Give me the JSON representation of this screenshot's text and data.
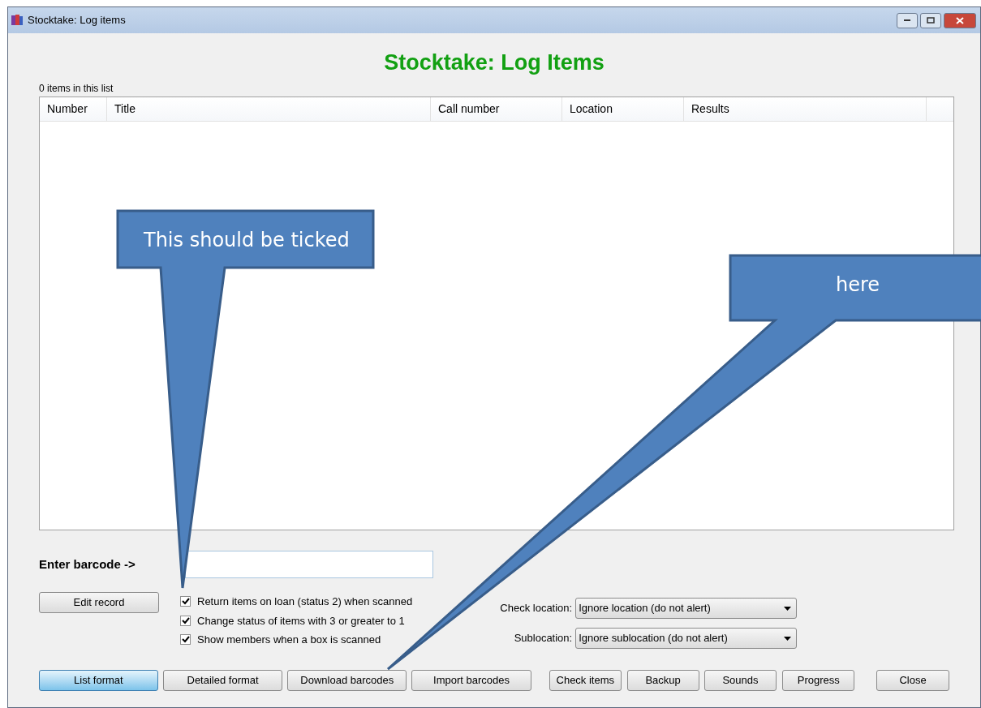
{
  "window": {
    "title": "Stocktake: Log items"
  },
  "heading": "Stocktake: Log Items",
  "item_count": "0 items in this list",
  "table": {
    "columns": [
      "Number",
      "Title",
      "Call number",
      "Location",
      "Results"
    ]
  },
  "barcode": {
    "label": "Enter barcode ->"
  },
  "edit_button": "Edit record",
  "options": [
    {
      "label": "Return items on loan (status 2) when scanned",
      "checked": true
    },
    {
      "label": "Change status of items with 3 or greater to 1",
      "checked": true
    },
    {
      "label": "Show members when a box is scanned",
      "checked": true
    }
  ],
  "selects": [
    {
      "label": "Check location:",
      "value": "Ignore location (do not alert)"
    },
    {
      "label": "Sublocation:",
      "value": "Ignore sublocation (do not alert)"
    }
  ],
  "buttons": [
    {
      "label": "List format",
      "selected": true
    },
    {
      "label": "Detailed format",
      "selected": false
    },
    {
      "label": "Download barcodes",
      "selected": false
    },
    {
      "label": "Import barcodes",
      "selected": false
    },
    {
      "label": "Check items",
      "selected": false
    },
    {
      "label": "Backup",
      "selected": false
    },
    {
      "label": "Sounds",
      "selected": false
    },
    {
      "label": "Progress",
      "selected": false
    },
    {
      "label": "Close",
      "selected": false
    }
  ],
  "callouts": [
    "This should be ticked",
    "here"
  ]
}
